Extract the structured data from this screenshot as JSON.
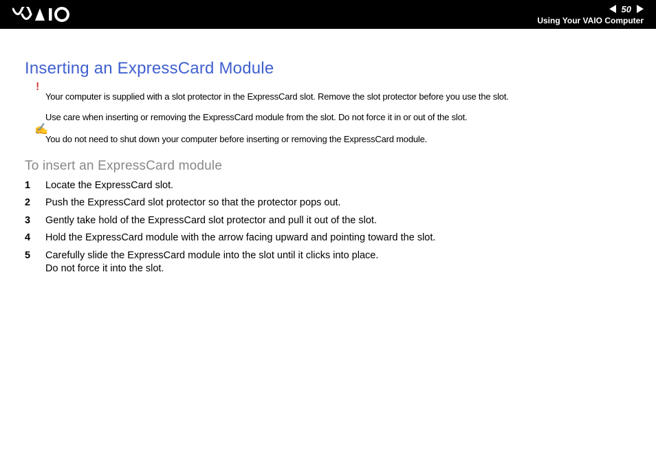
{
  "header": {
    "logo_text": "VAIO",
    "page_number": "50",
    "breadcrumb": "Using Your VAIO Computer"
  },
  "content": {
    "title": "Inserting an ExpressCard Module",
    "caution_icon": "!",
    "caution_line1": "Your computer is supplied with a slot protector in the ExpressCard slot. Remove the slot protector before you use the slot.",
    "caution_line2": "Use care when inserting or removing the ExpressCard module from the slot. Do not force it in or out of the slot.",
    "note_icon": "✍",
    "note_line": "You do not need to shut down your computer before inserting or removing the ExpressCard module.",
    "subtitle": "To insert an ExpressCard module",
    "steps": [
      {
        "n": "1",
        "text": "Locate the ExpressCard slot."
      },
      {
        "n": "2",
        "text": "Push the ExpressCard slot protector so that the protector pops out."
      },
      {
        "n": "3",
        "text": "Gently take hold of the ExpressCard slot protector and pull it out of the slot."
      },
      {
        "n": "4",
        "text": "Hold the ExpressCard module with the arrow facing upward and pointing toward the slot."
      },
      {
        "n": "5",
        "text": "Carefully slide the ExpressCard module into the slot until it clicks into place.\nDo not force it into the slot."
      }
    ]
  }
}
